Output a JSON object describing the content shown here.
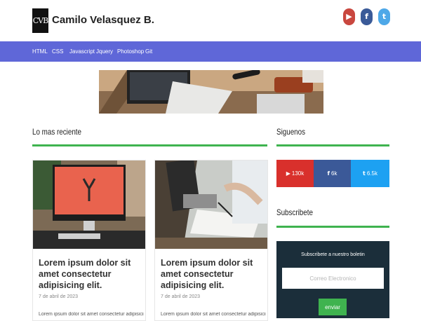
{
  "header": {
    "logo_text": "CVB",
    "title": "Camilo Velasquez B.",
    "social": {
      "youtube_glyph": "▶",
      "facebook_glyph": "f",
      "twitter_glyph": "t"
    }
  },
  "nav": {
    "items": [
      "HTML",
      "CSS",
      "Javascript",
      "Jquery",
      "Photoshop",
      "Git"
    ]
  },
  "main": {
    "latest_heading": "Lo mas reciente",
    "posts": [
      {
        "title": "Lorem ipsum dolor sit amet consectetur adipisicing elit.",
        "date": "7 de abril de 2023",
        "excerpt": "Lorem ipsum dolor sit amet consectetur adipisicing"
      },
      {
        "title": "Lorem ipsum dolor sit amet consectetur adipisicing elit.",
        "date": "7 de abril de 2023",
        "excerpt": "Lorem ipsum dolor sit amet consectetur adipisicing"
      }
    ]
  },
  "sidebar": {
    "follow_heading": "Siguenos",
    "follow": [
      {
        "icon": "youtube-icon",
        "glyph": "▶",
        "count": "130k"
      },
      {
        "icon": "facebook-icon",
        "glyph": "f",
        "count": "6k"
      },
      {
        "icon": "twitter-icon",
        "glyph": "t",
        "count": "6.5k"
      }
    ],
    "subscribe_heading": "Subscribete",
    "subscribe_text": "Subscribete a nuestro boletin",
    "email_placeholder": "Correo Electronico",
    "submit_label": "enviar"
  },
  "colors": {
    "nav": "#5f67d8",
    "accent_green": "#3fb34f",
    "youtube": "#d9302c",
    "facebook": "#3b5998",
    "twitter": "#1da1f2",
    "subscribe_bg": "#1b2e3a"
  }
}
